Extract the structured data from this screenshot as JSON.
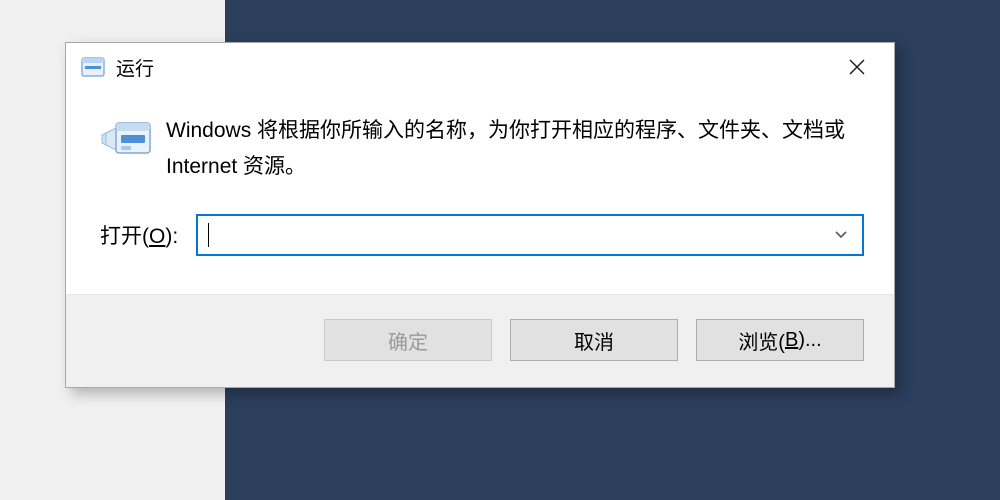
{
  "dialog": {
    "title": "运行",
    "description": "Windows 将根据你所输入的名称，为你打开相应的程序、文件夹、文档或 Internet 资源。",
    "open_label_prefix": "打开(",
    "open_label_key": "O",
    "open_label_suffix": "):",
    "input_value": "",
    "buttons": {
      "ok": "确定",
      "cancel": "取消",
      "browse_prefix": "浏览(",
      "browse_key": "B",
      "browse_suffix": ")..."
    }
  }
}
